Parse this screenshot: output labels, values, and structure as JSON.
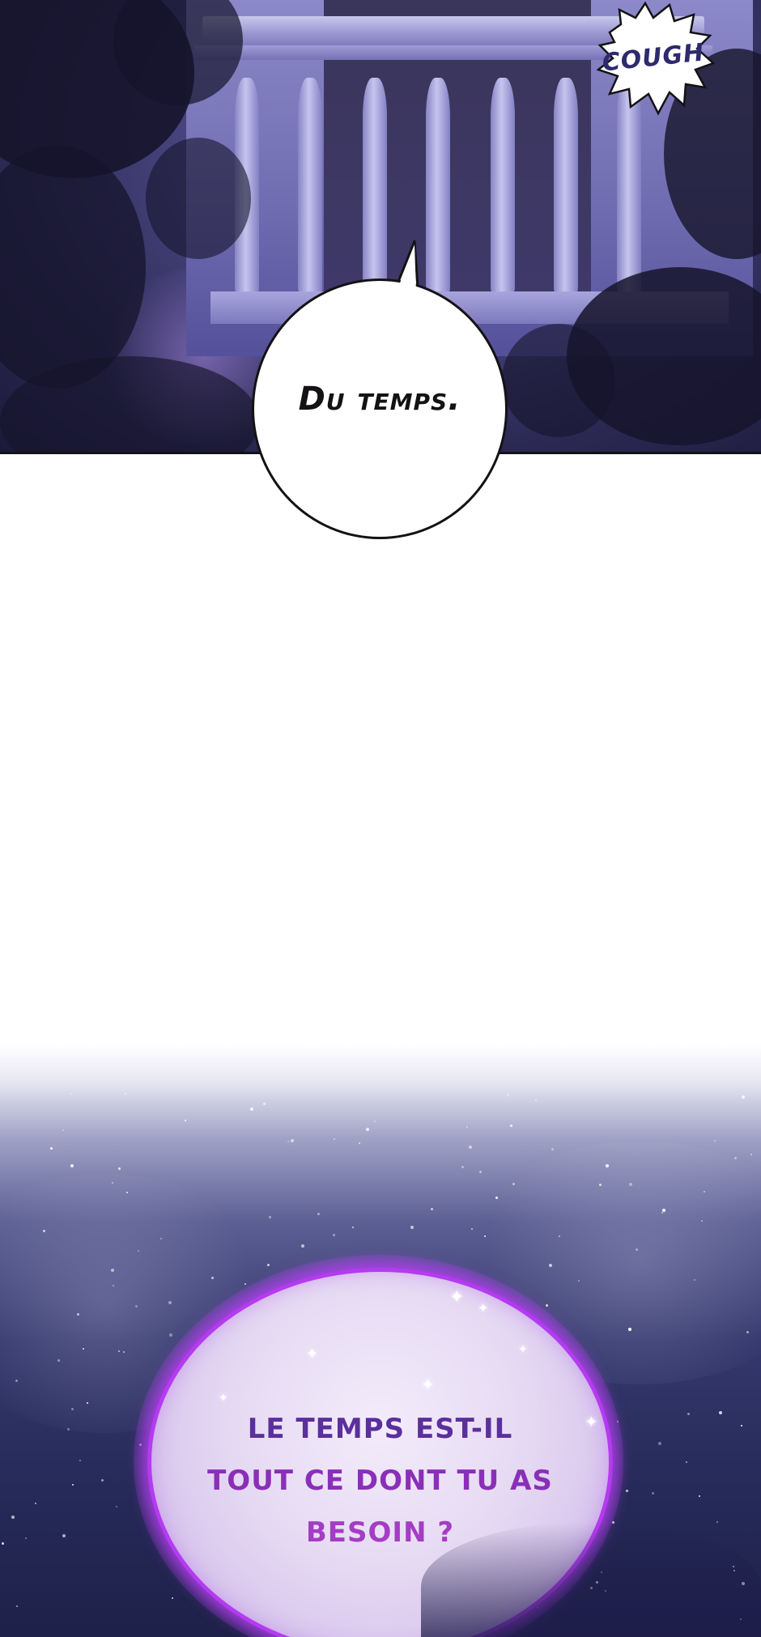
{
  "panel_1": {
    "sfx": "COUGH",
    "speech_bubble": "Du temps."
  },
  "panel_2": {
    "thought_bubble_lines": [
      "LE TEMPS EST-IL",
      "TOUT CE DONT TU AS",
      "BESOIN ?"
    ]
  },
  "colors": {
    "night_sky": "#2c2a55",
    "balcony": "#9d9ad3",
    "speech_outline": "#141214",
    "orb_border": "#b43bf0",
    "orb_text_top": "#5b2f9c",
    "orb_text_bottom": "#a43dc4",
    "sfx_text": "#2d2a6e"
  }
}
